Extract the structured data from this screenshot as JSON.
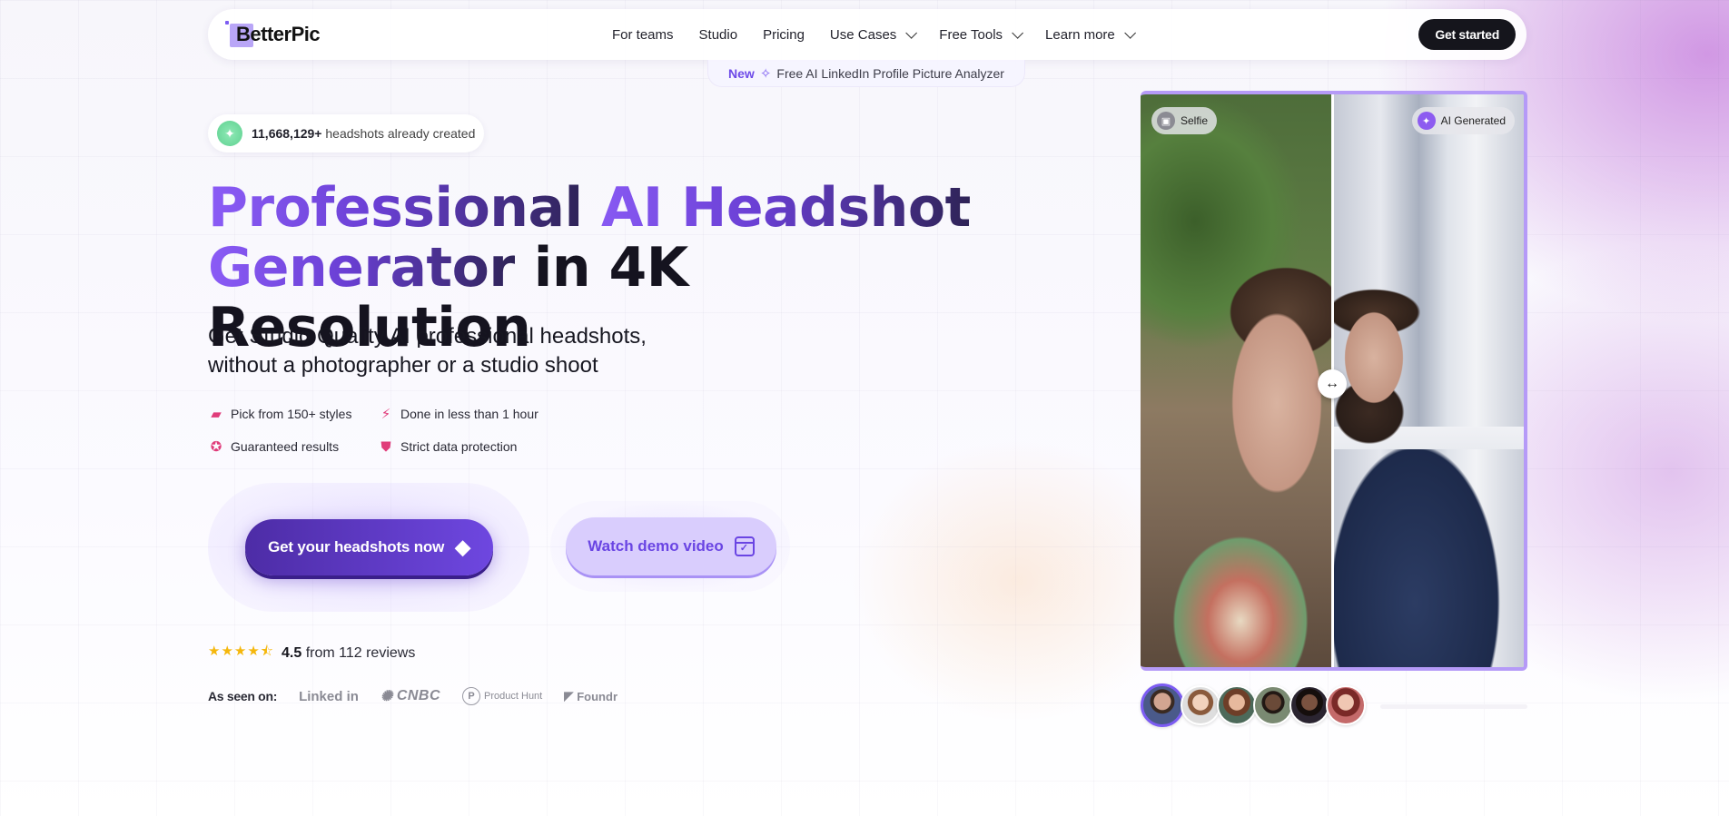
{
  "nav": {
    "logo_text": "BetterPic",
    "links": [
      {
        "label": "For teams",
        "has_dropdown": false
      },
      {
        "label": "Studio",
        "has_dropdown": false
      },
      {
        "label": "Pricing",
        "has_dropdown": false
      },
      {
        "label": "Use Cases",
        "has_dropdown": true
      },
      {
        "label": "Free Tools",
        "has_dropdown": true
      },
      {
        "label": "Learn more",
        "has_dropdown": true
      }
    ],
    "cta_label": "Get started"
  },
  "announcement": {
    "badge": "New",
    "text": "Free AI LinkedIn Profile Picture Analyzer"
  },
  "hero": {
    "counter": {
      "value": "11,668,129+",
      "suffix": "headshots already created"
    },
    "headline": {
      "line1_accent": "Professional",
      "line1_rest": " AI Headshot",
      "line2_accent": "Generator",
      "line2_rest": " in 4K Resolution"
    },
    "subhead_line1": "Get Studio Quality AI professional headshots,",
    "subhead_line2": "without a photographer or a studio shoot",
    "features": [
      {
        "icon": "swatch-icon",
        "label": "Pick from 150+ styles"
      },
      {
        "icon": "lightning-icon",
        "label": "Done in less than 1 hour"
      },
      {
        "icon": "award-icon",
        "label": "Guaranteed results"
      },
      {
        "icon": "shield-check-icon",
        "label": "Strict data protection"
      }
    ],
    "primary_cta": "Get your headshots now",
    "secondary_cta": "Watch demo video",
    "rating": {
      "stars": 4.5,
      "score": "4.5",
      "text": "from 112 reviews"
    },
    "as_seen_on": {
      "label": "As seen on:",
      "outlets": [
        "Linked in",
        "CNBC",
        "Product Hunt",
        "Foundr"
      ]
    }
  },
  "comparison": {
    "left_label": "Selfie",
    "right_label": "AI Generated",
    "slider_position": 0.5,
    "avatars_count": 6,
    "active_avatar_index": 0,
    "carousel_progress": 0
  },
  "colors": {
    "accent": "#6d4ae8",
    "accent_light": "#d9cdfd",
    "feature_icon": "#e03c7a",
    "star": "#f5b70c",
    "dark_button": "#15151c"
  }
}
